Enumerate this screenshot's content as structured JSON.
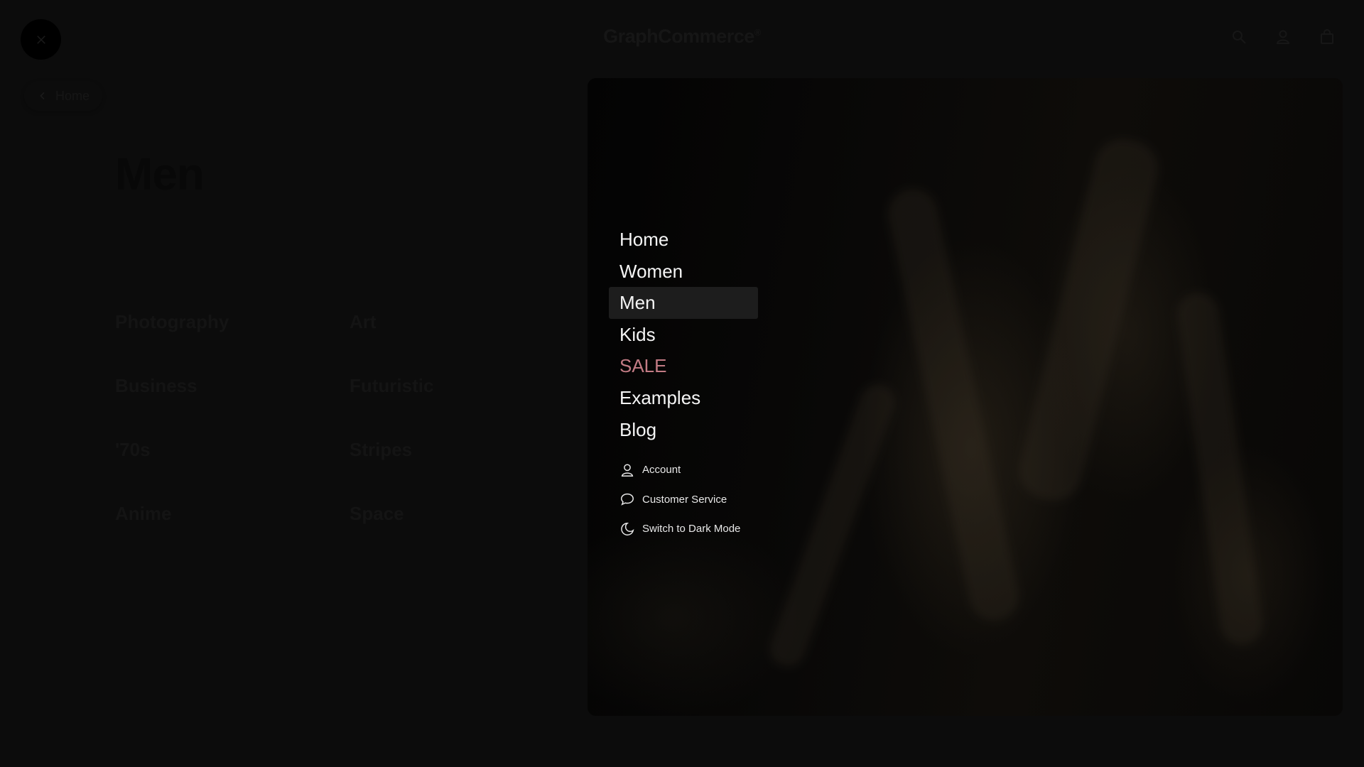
{
  "header": {
    "brand": "GraphCommerce",
    "brand_mark": "®",
    "close_icon": "close-icon",
    "icons": [
      "search-icon",
      "account-icon",
      "cart-icon"
    ]
  },
  "page": {
    "back_label": "Home",
    "title": "Men",
    "categories": [
      "Photography",
      "Art",
      "Business",
      "Futuristic",
      "'70s",
      "Stripes",
      "Anime",
      "Space"
    ]
  },
  "menu": {
    "items": [
      {
        "label": "Home"
      },
      {
        "label": "Women"
      },
      {
        "label": "Men"
      },
      {
        "label": "Kids"
      },
      {
        "label": "SALE"
      },
      {
        "label": "Examples"
      },
      {
        "label": "Blog"
      }
    ],
    "active": "Men",
    "sale_color": "#c27b84",
    "secondary": [
      {
        "label": "Account",
        "icon": "account-icon"
      },
      {
        "label": "Customer Service",
        "icon": "chat-icon"
      },
      {
        "label": "Switch to Dark Mode",
        "icon": "moon-icon"
      }
    ]
  }
}
